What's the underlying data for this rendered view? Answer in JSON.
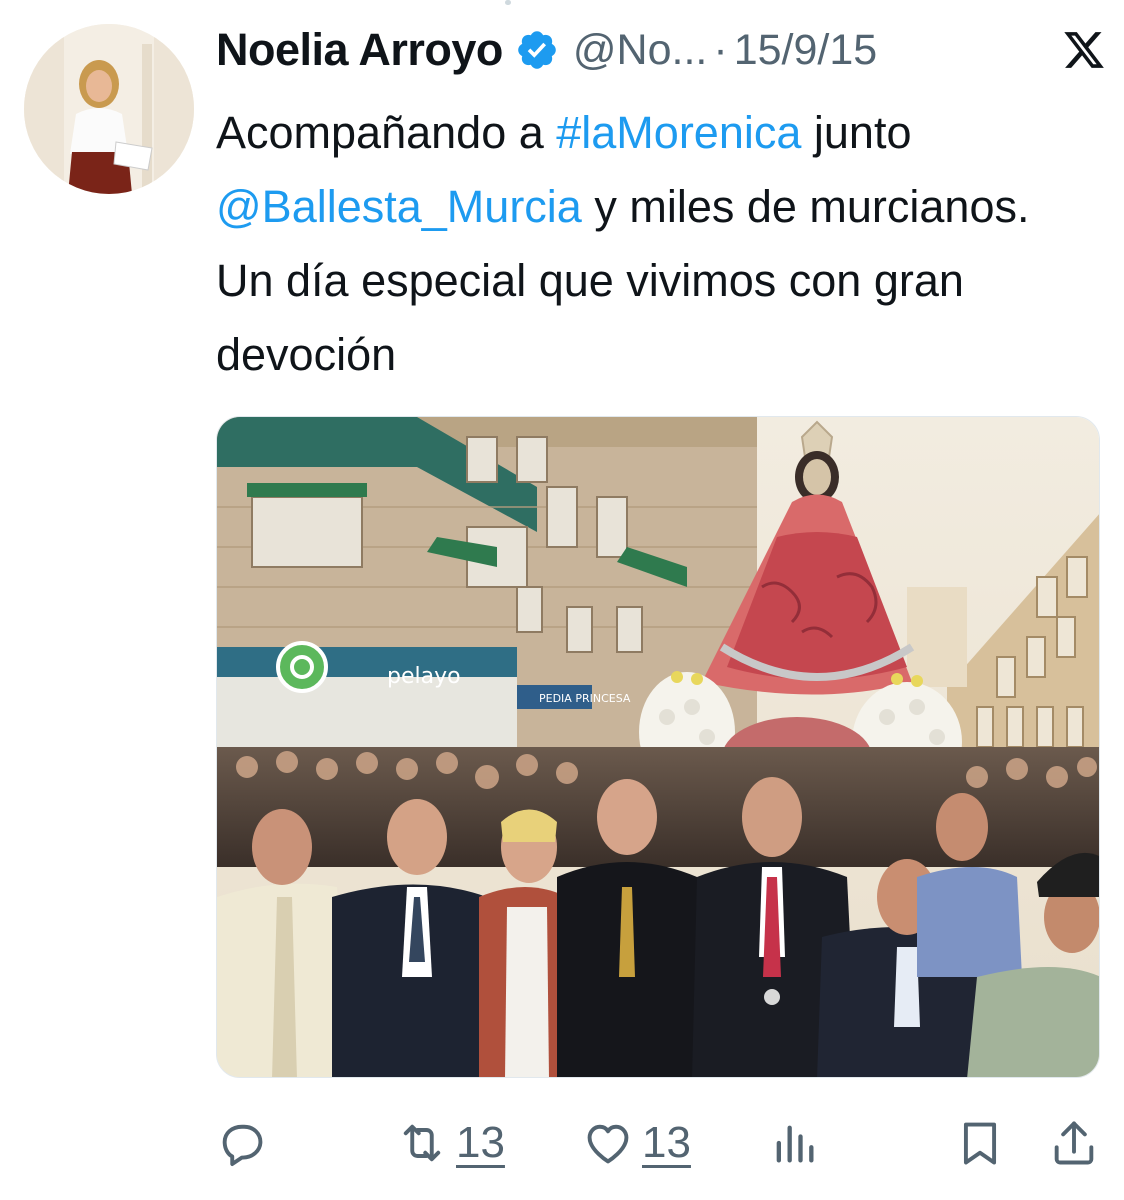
{
  "tweet": {
    "author": {
      "display_name": "Noelia Arroyo",
      "handle": "@No...",
      "verified": true
    },
    "separator": "·",
    "date": "15/9/15",
    "text": {
      "part1": "Acompañando a ",
      "hashtag": "#laMorenica",
      "part2": " junto ",
      "mention": "@Ballesta_Murcia",
      "part3": " y miles de murcianos. Un día especial que vivimos con gran devoción"
    },
    "media": {
      "type": "photo",
      "signs": {
        "pelayo": "pelayo",
        "shop": "PEDIA PRINCESA"
      }
    },
    "actions": {
      "reply": {
        "icon": "reply-icon"
      },
      "retweet": {
        "icon": "retweet-icon",
        "count": "13"
      },
      "like": {
        "icon": "heart-icon",
        "count": "13"
      },
      "views": {
        "icon": "views-icon"
      },
      "bookmark": {
        "icon": "bookmark-icon"
      },
      "share": {
        "icon": "share-icon"
      }
    }
  },
  "colors": {
    "link": "#1d9bf0",
    "secondary_text": "#536471",
    "primary_text": "#0f1419",
    "verified_badge": "#1d9bf0"
  }
}
